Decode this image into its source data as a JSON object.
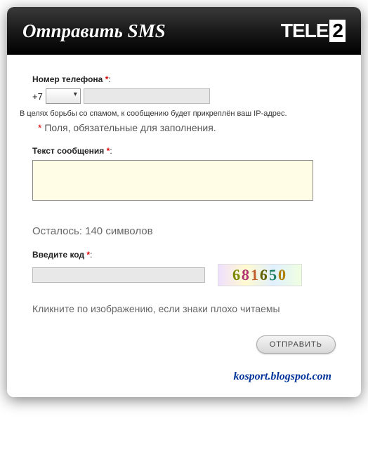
{
  "header": {
    "title": "Отправить SMS",
    "logo_part1": "TELE",
    "logo_part2": "2"
  },
  "form": {
    "phone": {
      "label": "Номер телефона",
      "prefix": "+7",
      "select_value": "",
      "input_value": ""
    },
    "spam_notice": "В целях борьбы со спамом, к сообщению будет прикреплён ваш IP-адрес.",
    "required_notice_star": "*",
    "required_notice": " Поля, обязательные для заполнения.",
    "message": {
      "label": "Текст сообщения",
      "value": ""
    },
    "chars_left": "Осталось: 140 символов",
    "captcha": {
      "label": "Введите код",
      "input_value": "",
      "digits": [
        "6",
        "8",
        "1",
        "6",
        "5",
        "0"
      ],
      "hint": "Кликните по изображению, если знаки плохо читаемы"
    },
    "submit_label": "ОТПРАВИТЬ"
  },
  "watermark": "kosport.blogspot.com"
}
